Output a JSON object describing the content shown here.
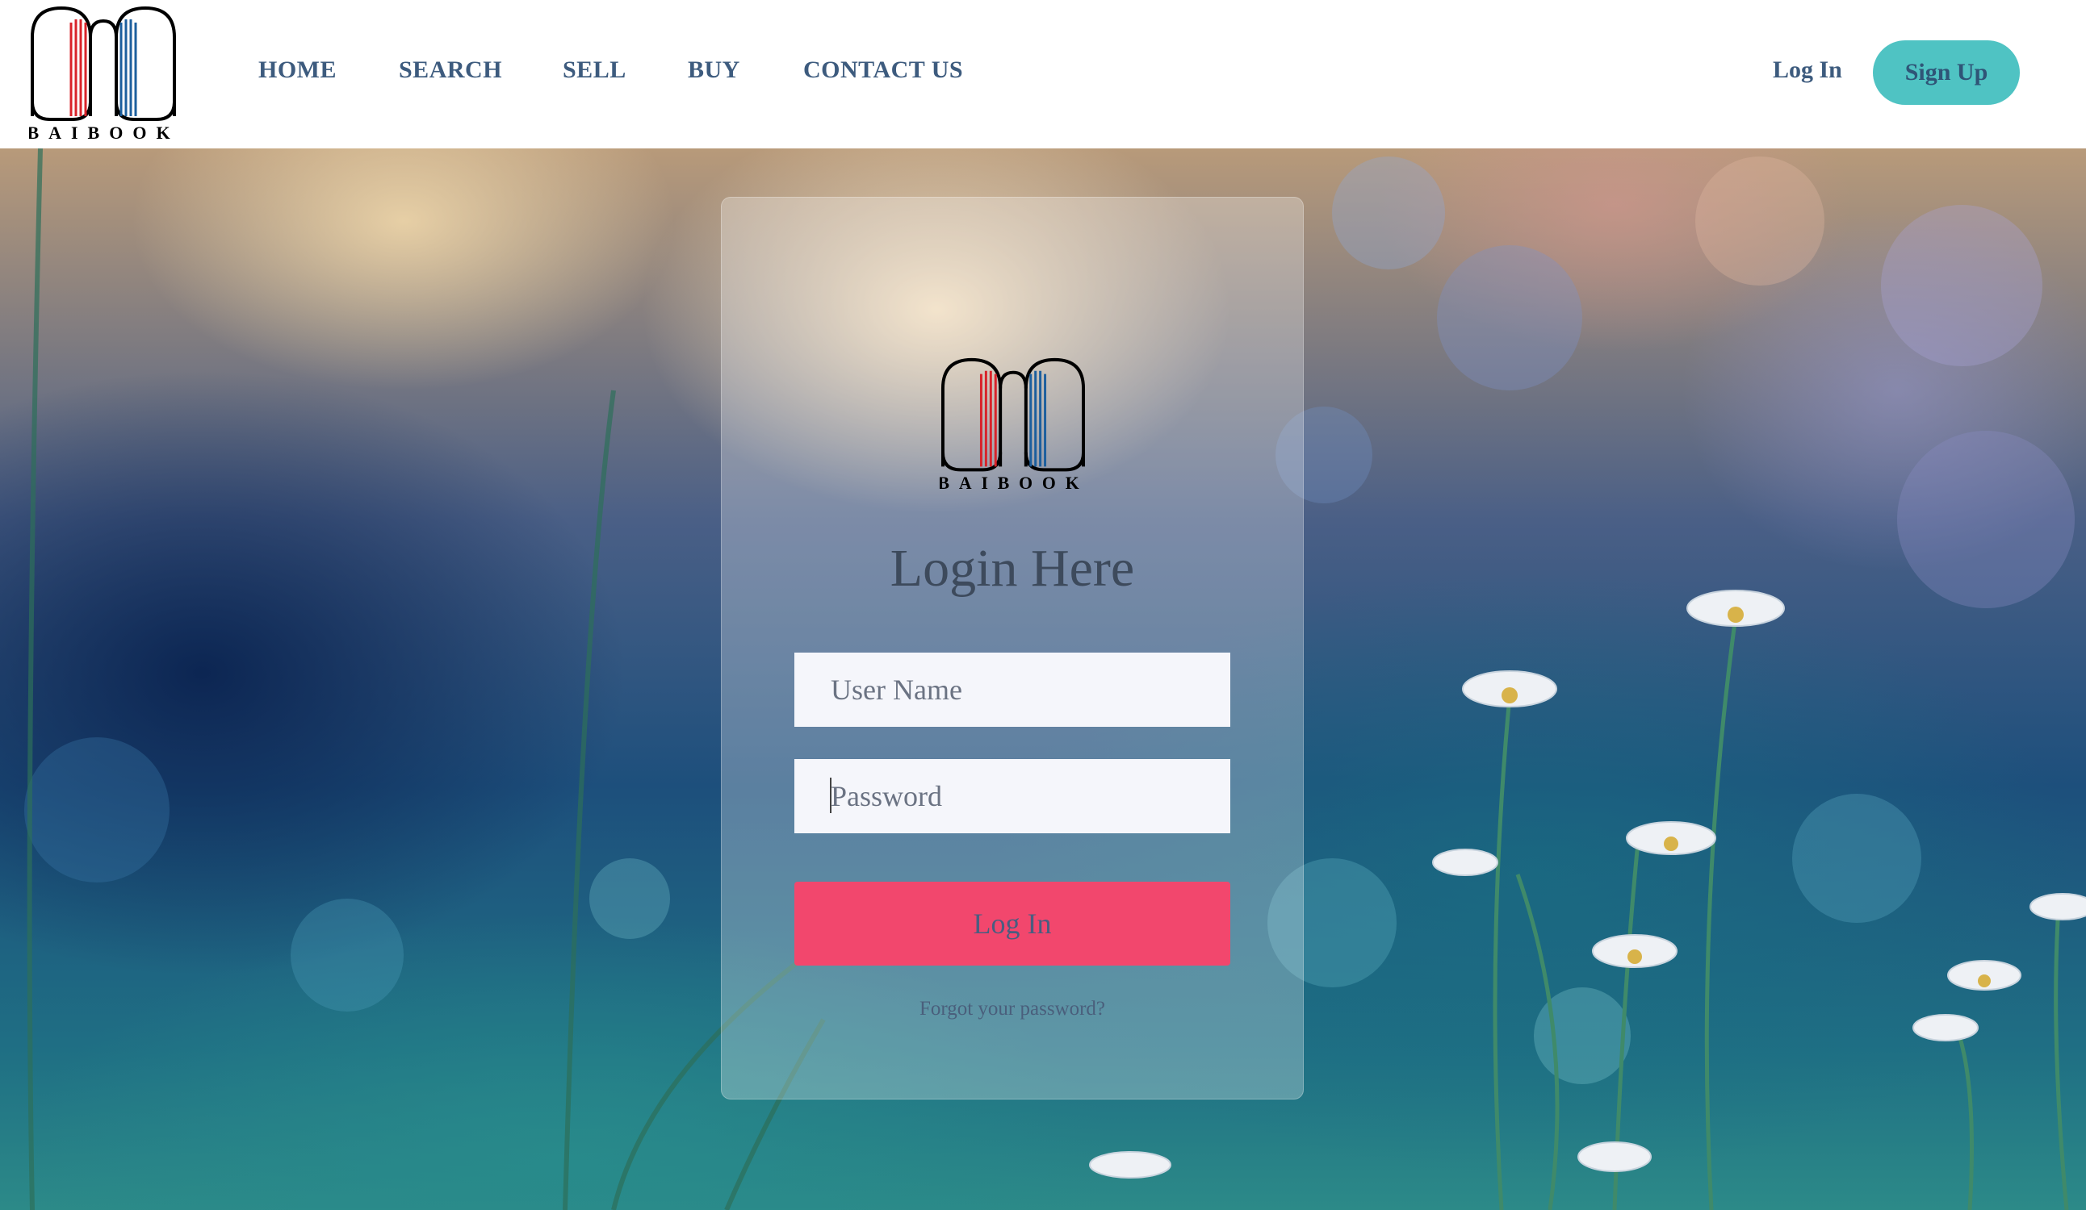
{
  "brand": {
    "name": "BAIBOOK"
  },
  "nav": {
    "items": [
      "HOME",
      "SEARCH",
      "SELL",
      "BUY",
      "CONTACT US"
    ],
    "login_label": "Log In",
    "signup_label": "Sign Up"
  },
  "login_form": {
    "title": "Login Here",
    "username_placeholder": "User Name",
    "password_placeholder": "Password",
    "submit_label": "Log In",
    "forgot_label": "Forgot your password?"
  },
  "colors": {
    "nav_text": "#3d5b7e",
    "signup_bg": "#4fc3c3",
    "login_button_bg": "#f2476d",
    "logo_red": "#d8232a",
    "logo_blue": "#1c5f9e"
  },
  "icons": {
    "brand_logo": "book-arch-logo"
  }
}
